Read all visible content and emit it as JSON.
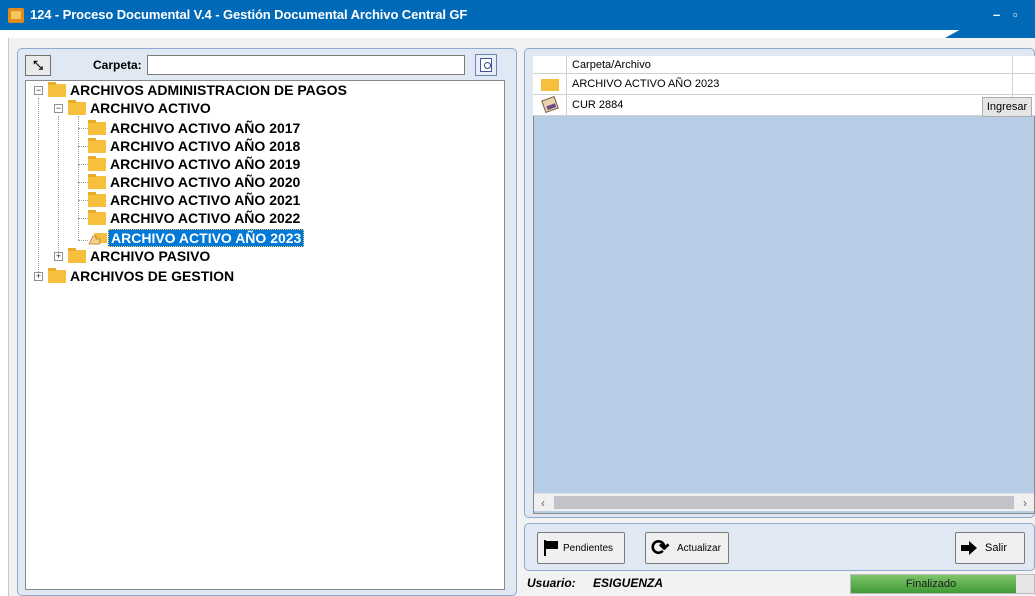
{
  "window": {
    "title": "124 - Proceso Documental V.4 - Gestión Documental Archivo Central GF",
    "minimize_glyph": "–",
    "maximize_glyph": "▫"
  },
  "search": {
    "label": "Carpeta:",
    "value": "",
    "placeholder": ""
  },
  "tree": {
    "root": {
      "label": "ARCHIVOS ADMINISTRACION DE PAGOS",
      "expanded": true
    },
    "activo": {
      "label": "ARCHIVO ACTIVO",
      "expanded": true
    },
    "years": [
      {
        "label": "ARCHIVO ACTIVO AÑO 2017"
      },
      {
        "label": "ARCHIVO ACTIVO AÑO 2018"
      },
      {
        "label": "ARCHIVO ACTIVO AÑO 2019"
      },
      {
        "label": "ARCHIVO ACTIVO AÑO 2020"
      },
      {
        "label": "ARCHIVO ACTIVO AÑO 2021"
      },
      {
        "label": "ARCHIVO ACTIVO AÑO 2022"
      },
      {
        "label": "ARCHIVO ACTIVO AÑO 2023",
        "selected": true
      }
    ],
    "pasivo": {
      "label": "ARCHIVO PASIVO",
      "expanded": false
    },
    "gestion": {
      "label": "ARCHIVOS DE GESTION",
      "expanded": false
    }
  },
  "grid": {
    "column_header": "Carpeta/Archivo",
    "rows": [
      {
        "icon": "folder-icon",
        "name": "ARCHIVO ACTIVO AÑO 2023",
        "action": ""
      },
      {
        "icon": "document-icon",
        "name": "CUR 2884",
        "action": "Ingresar"
      }
    ]
  },
  "buttons": {
    "pendientes": "Pendientes",
    "actualizar": "Actualizar",
    "salir": "Salir"
  },
  "status": {
    "user_label": "Usuario:",
    "user_value": "ESIGUENZA",
    "progress_text": "Finalizado",
    "progress_fraction": 0.9
  },
  "colors": {
    "titlebar": "#0069b8",
    "selection": "#0078d7",
    "folder": "#f7c03c",
    "grid_background": "#b7cde6",
    "progress": "#3f9a35"
  }
}
